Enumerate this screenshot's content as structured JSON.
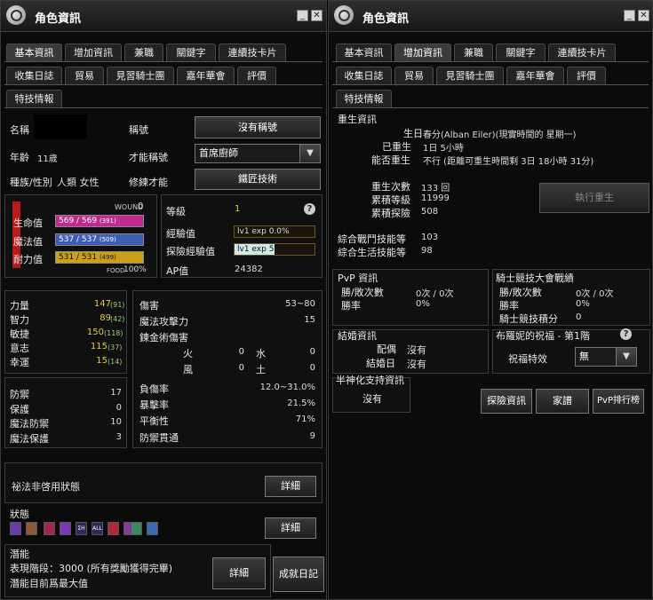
{
  "left": {
    "title": "角色資訊",
    "tabs_row1": [
      "基本資訊",
      "增加資訊",
      "兼職",
      "關鍵字",
      "連續技卡片"
    ],
    "tabs_row2": [
      "收集日誌",
      "貿易",
      "見習騎士團",
      "嘉年華會",
      "評價"
    ],
    "tabs_row3": [
      "特技情報"
    ],
    "info": {
      "name_label": "名稱",
      "title_label": "稱號",
      "title_value": "沒有稱號",
      "age_label": "年齡",
      "age_value": "11歲",
      "talent_title_label": "才能稱號",
      "talent_title_value": "首席廚師",
      "race_label": "種族/性別",
      "race_value": "人類 女性",
      "talent_mod_label": "修練才能",
      "talent_mod_value": "鐵匠技術"
    },
    "vitals": {
      "wound_label": "WOUND",
      "wound_value": "0",
      "hp_label": "生命值",
      "hp_value": "569 / 569",
      "hp_max": "(391)",
      "mp_label": "魔法值",
      "mp_value": "537 / 537",
      "mp_max": "(509)",
      "sp_label": "耐力值",
      "sp_value": "531 / 531",
      "sp_max": "(499)",
      "food_label": "FOOD",
      "food_value": "100%"
    },
    "level": {
      "level_label": "等級",
      "level_value": "1",
      "exp_label": "經驗值",
      "exp_value": "lv1 exp 0.0%",
      "exp_fill": 0.0,
      "adv_exp_label": "探險經驗值",
      "adv_exp_value": "lv1 exp 50.0%",
      "adv_exp_fill": 0.5,
      "ap_label": "AP值",
      "ap_value": "24382"
    },
    "stats": [
      {
        "label": "力量",
        "value": "147",
        "base": "(91)"
      },
      {
        "label": "智力",
        "value": "89",
        "base": "(42)"
      },
      {
        "label": "敏捷",
        "value": "150",
        "base": "(118)"
      },
      {
        "label": "意志",
        "value": "115",
        "base": "(37)"
      },
      {
        "label": "幸運",
        "value": "15",
        "base": "(14)"
      }
    ],
    "defense": [
      {
        "label": "防禦",
        "value": "17"
      },
      {
        "label": "保護",
        "value": "0"
      },
      {
        "label": "魔法防禦",
        "value": "10"
      },
      {
        "label": "魔法保護",
        "value": "3"
      }
    ],
    "combat": {
      "damage_label": "傷害",
      "damage_value": "53~80",
      "magic_atk_label": "魔法攻擊力",
      "magic_atk_value": "15",
      "alchemy_label": "鍊金術傷害",
      "fire_label": "火",
      "fire_value": "0",
      "water_label": "水",
      "water_value": "0",
      "wind_label": "風",
      "wind_value": "0",
      "earth_label": "土",
      "earth_value": "0",
      "injury_label": "負傷率",
      "injury_value": "12.0~31.0%",
      "crit_label": "暴擊率",
      "crit_value": "21.5%",
      "balance_label": "平衡性",
      "balance_value": "71%",
      "pierce_label": "防禦貫通",
      "pierce_value": "9"
    },
    "secret_label": "祕法非啓用狀態",
    "detail_label": "詳細",
    "status_label": "狀態",
    "status_icons": [
      "a",
      "b",
      "c",
      "d",
      "ΣH",
      "ALL",
      "e",
      "f",
      "g",
      "h"
    ],
    "potential_label": "潛能",
    "potential_stage": "表現階段：3000 (所有獎勵獲得完畢)",
    "potential_max": "潛能目前爲最大值",
    "achievement_label": "成就日記"
  },
  "right": {
    "title": "角色資訊",
    "tabs_row1": [
      "基本資訊",
      "增加資訊",
      "兼職",
      "關鍵字",
      "連續技卡片"
    ],
    "tabs_row2": [
      "收集日誌",
      "貿易",
      "見習騎士團",
      "嘉年華會",
      "評價"
    ],
    "tabs_row3": [
      "特技情報"
    ],
    "rebirth": {
      "heading": "重生資訊",
      "birthday_label": "生日",
      "birthday_value": "春分(Alban Eiler)(現實時間的 星期一)",
      "reborn_label": "已重生",
      "reborn_value": "1日 5小時",
      "can_label": "能否重生",
      "can_value": "不行 (距離可重生時間剩 3日 18小時 31分)",
      "count_label": "重生次數",
      "count_value": "133 回",
      "total_level_label": "累積等級",
      "total_level_value": "11999",
      "total_adv_label": "累積探險",
      "total_adv_value": "508",
      "execute_label": "執行重生",
      "combat_skill_label": "綜合戰鬥技能等",
      "combat_skill_value": "103",
      "life_skill_label": "綜合生活技能等",
      "life_skill_value": "98"
    },
    "pvp": {
      "heading": "PvP 資訊",
      "winloss_label": "勝/敗次數",
      "winloss_value": "0次 / 0次",
      "rate_label": "勝率",
      "rate_value": "0%"
    },
    "knight": {
      "heading": "騎士競技大會戰績",
      "winloss_label": "勝/敗次數",
      "winloss_value": "0次 / 0次",
      "rate_label": "勝率",
      "rate_value": "0%",
      "score_label": "騎士競技積分",
      "score_value": "0"
    },
    "marriage": {
      "heading": "結婚資訊",
      "spouse_label": "配偶",
      "spouse_value": "沒有",
      "date_label": "結婚日",
      "date_value": "沒有"
    },
    "blessing": {
      "heading": "布羅妮的祝福 - 第1階",
      "effect_label": "祝福特效",
      "effect_value": "無"
    },
    "demigod": {
      "heading": "半神化支持資訊",
      "value": "沒有"
    },
    "buttons": {
      "adventure": "探險資訊",
      "family": "家譜",
      "pvp_rank": "PvP排行榜"
    }
  }
}
